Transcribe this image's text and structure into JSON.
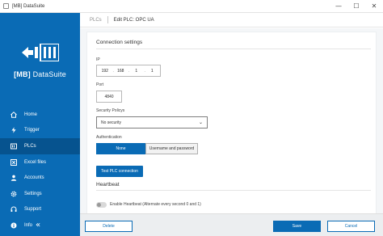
{
  "window": {
    "title": "[MB] DataSuite",
    "minimize_glyph": "—",
    "maximize_glyph": "☐",
    "close_glyph": "✕"
  },
  "brand": {
    "bracket_text": "[MB]",
    "name": "DataSuite",
    "color": "#0a6bb5"
  },
  "sidebar": {
    "items": [
      {
        "label": "Home",
        "icon": "home-icon"
      },
      {
        "label": "Trigger",
        "icon": "bolt-icon"
      },
      {
        "label": "PLCs",
        "icon": "plc-icon",
        "active": true
      },
      {
        "label": "Excel files",
        "icon": "excel-icon"
      },
      {
        "label": "Accounts",
        "icon": "user-icon"
      },
      {
        "label": "Settings",
        "icon": "gear-icon"
      },
      {
        "label": "Support",
        "icon": "headset-icon"
      },
      {
        "label": "Info",
        "icon": "info-icon"
      }
    ],
    "collapse_glyph": "«"
  },
  "breadcrumb": {
    "parent": "PLCs",
    "current": "Edit PLC: OPC UA"
  },
  "connection": {
    "title": "Connection settings",
    "ip_label": "IP",
    "ip": [
      "192",
      "168",
      "1",
      "1"
    ],
    "ip_sep": ".",
    "port_label": "Port",
    "port": "4840",
    "security_label": "Security Policys",
    "security_value": "No security",
    "auth_label": "Authentication",
    "auth_options": [
      "None",
      "Username and password"
    ],
    "auth_selected": "None",
    "test_button": "Test PLC connection"
  },
  "heartbeat": {
    "title": "Heartbeat",
    "toggle_label": "Enable Heartbeat (Alternate every second 0 and 1)",
    "enabled": false
  },
  "footer": {
    "delete": "Delete",
    "save": "Save",
    "cancel": "Cancel"
  }
}
